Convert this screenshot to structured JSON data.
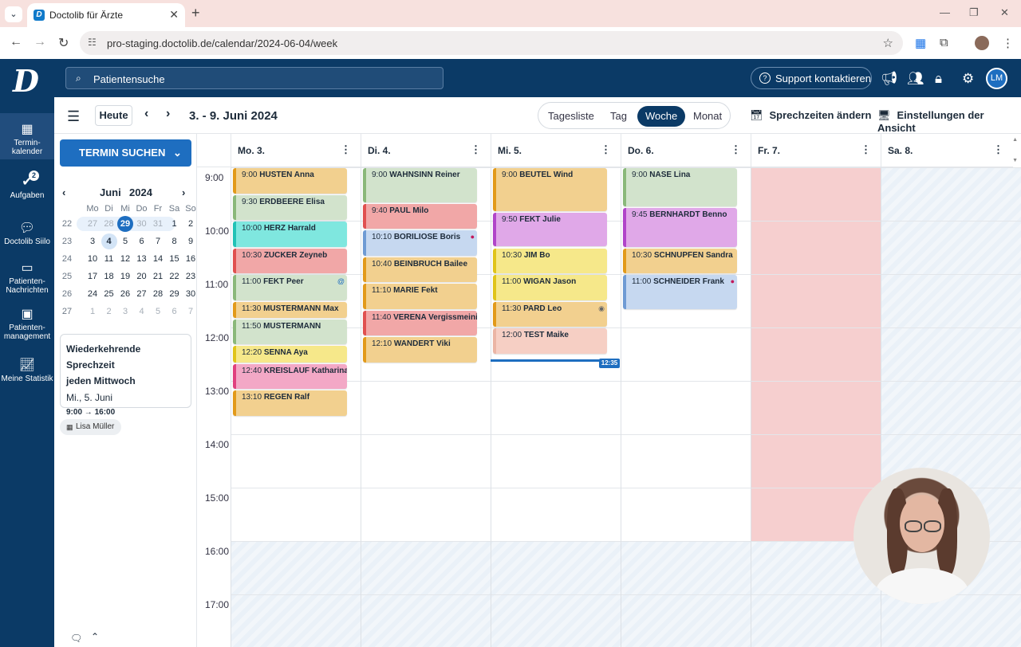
{
  "browser": {
    "tab_title": "Doctolib für Ärzte",
    "url": "pro-staging.doctolib.de/calendar/2024-06-04/week"
  },
  "header": {
    "search_placeholder": "Patientensuche",
    "support_label": "Support kontaktieren",
    "avatar_initials": "LM"
  },
  "leftnav": {
    "items": [
      {
        "label": "Termin-\nkalender",
        "icon": "calendar-icon"
      },
      {
        "label": "Aufgaben",
        "icon": "check-icon",
        "badge": "2"
      },
      {
        "label": "Doctolib Siilo",
        "icon": "chat-icon"
      },
      {
        "label": "Patienten-\nNachrichten",
        "icon": "message-icon"
      },
      {
        "label": "Patienten-\nmanagement",
        "icon": "patient-icon"
      },
      {
        "label": "Meine Statistik",
        "icon": "stats-icon"
      }
    ]
  },
  "toolbar": {
    "today_label": "Heute",
    "range": "3. - 9. Juni 2024",
    "views": [
      "Tagesliste",
      "Tag",
      "Woche",
      "Monat"
    ],
    "active_view": "Woche",
    "change_hours": "Sprechzeiten ändern",
    "view_settings": "Einstellungen der Ansicht"
  },
  "sidebar": {
    "search_button": "TERMIN SUCHEN",
    "month": "Juni",
    "year": "2024",
    "weekdays": [
      "Mo",
      "Di",
      "Mi",
      "Do",
      "Fr",
      "Sa",
      "So"
    ],
    "weeks": [
      {
        "wk": "22",
        "days": [
          "27",
          "28",
          "29",
          "30",
          "31",
          "1",
          "2"
        ]
      },
      {
        "wk": "23",
        "days": [
          "3",
          "4",
          "5",
          "6",
          "7",
          "8",
          "9"
        ]
      },
      {
        "wk": "24",
        "days": [
          "10",
          "11",
          "12",
          "13",
          "14",
          "15",
          "16"
        ]
      },
      {
        "wk": "25",
        "days": [
          "17",
          "18",
          "19",
          "20",
          "21",
          "22",
          "23"
        ]
      },
      {
        "wk": "26",
        "days": [
          "24",
          "25",
          "26",
          "27",
          "28",
          "29",
          "30"
        ]
      },
      {
        "wk": "27",
        "days": [
          "1",
          "2",
          "3",
          "4",
          "5",
          "6",
          "7"
        ]
      }
    ],
    "recurring": {
      "title_1": "Wiederkehrende Sprechzeit",
      "title_2": "jeden Mittwoch",
      "date": "Mi., 5. Juni",
      "hours": "9:00 → 16:00"
    },
    "doctor": "Lisa Müller"
  },
  "calendar": {
    "days": [
      "Mo. 3.",
      "Di. 4.",
      "Mi. 5.",
      "Do. 6.",
      "Fr. 7.",
      "Sa. 8."
    ],
    "hours": [
      "9:00",
      "10:00",
      "11:00",
      "12:00",
      "13:00",
      "14:00",
      "15:00",
      "16:00",
      "17:00"
    ],
    "now_label": "12:35",
    "appointments": [
      {
        "day": 0,
        "start": "9:00",
        "dur": 30,
        "time": "9:00",
        "name": "HUSTEN Anna",
        "color": "#f2d08f",
        "bar": "#e29a1a"
      },
      {
        "day": 0,
        "start": "9:30",
        "dur": 30,
        "time": "9:30",
        "name": "ERDBEERE Elisa",
        "color": "#d2e3cc",
        "bar": "#8ab87a"
      },
      {
        "day": 0,
        "start": "10:00",
        "dur": 30,
        "time": "10:00",
        "name": "HERZ Harrald",
        "color": "#7fe7df",
        "bar": "#22c2b6"
      },
      {
        "day": 0,
        "start": "10:30",
        "dur": 30,
        "time": "10:30",
        "name": "ZUCKER Zeyneb",
        "color": "#f1a7a7",
        "bar": "#e05050"
      },
      {
        "day": 0,
        "start": "11:00",
        "dur": 30,
        "time": "11:00",
        "name": "FEKT Peer",
        "color": "#d2e3cc",
        "bar": "#8ab87a",
        "mark": "@"
      },
      {
        "day": 0,
        "start": "11:30",
        "dur": 20,
        "time": "11:30",
        "name": "MUSTERMANN Max",
        "color": "#f2d08f",
        "bar": "#e29a1a"
      },
      {
        "day": 0,
        "start": "11:50",
        "dur": 30,
        "time": "11:50",
        "name": "MUSTERMANN",
        "color": "#d2e3cc",
        "bar": "#8ab87a"
      },
      {
        "day": 0,
        "start": "12:20",
        "dur": 20,
        "time": "12:20",
        "name": "SENNA Aya",
        "color": "#f6e88a",
        "bar": "#e0c41a"
      },
      {
        "day": 0,
        "start": "12:40",
        "dur": 30,
        "time": "12:40",
        "name": "KREISLAUF Katharina",
        "color": "#f3a8c6",
        "bar": "#e0407e"
      },
      {
        "day": 0,
        "start": "13:10",
        "dur": 30,
        "time": "13:10",
        "name": "REGEN Ralf",
        "color": "#f2d08f",
        "bar": "#e29a1a"
      },
      {
        "day": 1,
        "start": "9:00",
        "dur": 40,
        "time": "9:00",
        "name": "WAHNSINN Reiner",
        "color": "#d2e3cc",
        "bar": "#8ab87a"
      },
      {
        "day": 1,
        "start": "9:40",
        "dur": 30,
        "time": "9:40",
        "name": "PAUL Milo",
        "color": "#f1a7a7",
        "bar": "#e05050"
      },
      {
        "day": 1,
        "start": "10:10",
        "dur": 30,
        "time": "10:10",
        "name": "BORILIOSE Boris",
        "color": "#c6d8f0",
        "bar": "#6f9bd4",
        "mark": "●"
      },
      {
        "day": 1,
        "start": "10:40",
        "dur": 30,
        "time": "10:40",
        "name": "BEINBRUCH Bailee",
        "color": "#f2d08f",
        "bar": "#e29a1a"
      },
      {
        "day": 1,
        "start": "11:10",
        "dur": 30,
        "time": "11:10",
        "name": "MARIE Fekt",
        "color": "#f2d08f",
        "bar": "#e29a1a"
      },
      {
        "day": 1,
        "start": "11:40",
        "dur": 30,
        "time": "11:40",
        "name": "VERENA Vergissmeinicht",
        "color": "#f1a7a7",
        "bar": "#e05050"
      },
      {
        "day": 1,
        "start": "12:10",
        "dur": 30,
        "time": "12:10",
        "name": "WANDERT Viki",
        "color": "#f2d08f",
        "bar": "#e29a1a"
      },
      {
        "day": 2,
        "start": "9:00",
        "dur": 50,
        "time": "9:00",
        "name": "BEUTEL Wind",
        "color": "#f2d08f",
        "bar": "#e29a1a"
      },
      {
        "day": 2,
        "start": "9:50",
        "dur": 40,
        "time": "9:50",
        "name": "FEKT Julie",
        "color": "#e0a8e8",
        "bar": "#b045c9"
      },
      {
        "day": 2,
        "start": "10:30",
        "dur": 30,
        "time": "10:30",
        "name": "JIM Bo",
        "color": "#f6e88a",
        "bar": "#e0c41a"
      },
      {
        "day": 2,
        "start": "11:00",
        "dur": 30,
        "time": "11:00",
        "name": "WIGAN Jason",
        "color": "#f6e88a",
        "bar": "#e0c41a"
      },
      {
        "day": 2,
        "start": "11:30",
        "dur": 30,
        "time": "11:30",
        "name": "PARD Leo",
        "color": "#f2d08f",
        "bar": "#e29a1a",
        "mark": "◉"
      },
      {
        "day": 2,
        "start": "12:00",
        "dur": 30,
        "time": "12:00",
        "name": "TEST Maike",
        "color": "#f6cfc4",
        "bar": "#ebb5a5"
      },
      {
        "day": 3,
        "start": "9:00",
        "dur": 45,
        "time": "9:00",
        "name": "NASE Lina",
        "color": "#d2e3cc",
        "bar": "#8ab87a"
      },
      {
        "day": 3,
        "start": "9:45",
        "dur": 45,
        "time": "9:45",
        "name": "BERNHARDT Benno",
        "color": "#e0a8e8",
        "bar": "#b045c9"
      },
      {
        "day": 3,
        "start": "10:30",
        "dur": 30,
        "time": "10:30",
        "name": "SCHNUPFEN Sandra",
        "color": "#f2d08f",
        "bar": "#e29a1a"
      },
      {
        "day": 3,
        "start": "11:00",
        "dur": 40,
        "time": "11:00",
        "name": "SCHNEIDER Frank",
        "color": "#c6d8f0",
        "bar": "#6f9bd4",
        "mark": "●"
      }
    ]
  },
  "colors": {
    "brand_dark": "#0b3a66",
    "brand_blue": "#1e6ec0",
    "closed_day": "#f6cfcf"
  }
}
